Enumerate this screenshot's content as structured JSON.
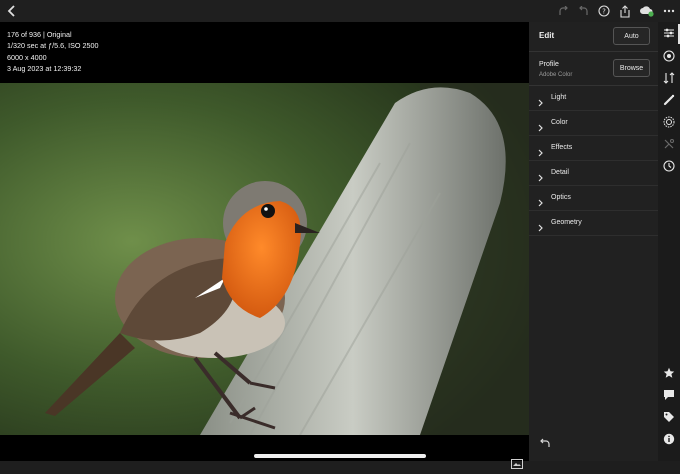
{
  "photo_info": {
    "position": "176 of 936 | Original",
    "exposure": "1/320 sec at ƒ/5.6, ISO 2500",
    "dimensions": "6000 x 4000",
    "date": "3 Aug 2023 at 12:39:32"
  },
  "toolbar": {
    "icons": [
      "back-icon",
      "redo-icon",
      "undo-icon",
      "help-icon",
      "share-icon",
      "cloud-sync-icon",
      "more-icon"
    ]
  },
  "edit_panel": {
    "title": "Edit",
    "auto_label": "Auto",
    "profile_label": "Profile",
    "profile_value": "Adobe Color",
    "browse_label": "Browse",
    "sections": [
      "Light",
      "Color",
      "Effects",
      "Detail",
      "Optics",
      "Geometry"
    ]
  },
  "rail": {
    "top_icons": [
      "edit-sliders-icon",
      "presets-icon",
      "versions-icon",
      "healing-brush-icon",
      "masking-icon",
      "selective-edit-icon",
      "history-icon"
    ],
    "bottom_icons": [
      "rating-star-icon",
      "comments-icon",
      "keywords-tag-icon",
      "info-icon"
    ]
  },
  "colors": {
    "accent_sync": "#4caf50",
    "panel_bg": "#212121",
    "rail_bg": "#1b1b1b"
  }
}
